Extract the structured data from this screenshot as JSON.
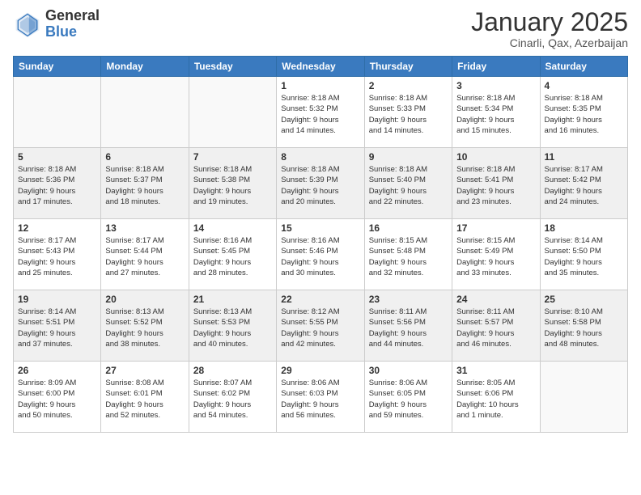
{
  "header": {
    "logo_general": "General",
    "logo_blue": "Blue",
    "month_title": "January 2025",
    "location": "Cinarli, Qax, Azerbaijan"
  },
  "weekdays": [
    "Sunday",
    "Monday",
    "Tuesday",
    "Wednesday",
    "Thursday",
    "Friday",
    "Saturday"
  ],
  "weeks": [
    [
      {
        "day": "",
        "info": ""
      },
      {
        "day": "",
        "info": ""
      },
      {
        "day": "",
        "info": ""
      },
      {
        "day": "1",
        "info": "Sunrise: 8:18 AM\nSunset: 5:32 PM\nDaylight: 9 hours\nand 14 minutes."
      },
      {
        "day": "2",
        "info": "Sunrise: 8:18 AM\nSunset: 5:33 PM\nDaylight: 9 hours\nand 14 minutes."
      },
      {
        "day": "3",
        "info": "Sunrise: 8:18 AM\nSunset: 5:34 PM\nDaylight: 9 hours\nand 15 minutes."
      },
      {
        "day": "4",
        "info": "Sunrise: 8:18 AM\nSunset: 5:35 PM\nDaylight: 9 hours\nand 16 minutes."
      }
    ],
    [
      {
        "day": "5",
        "info": "Sunrise: 8:18 AM\nSunset: 5:36 PM\nDaylight: 9 hours\nand 17 minutes."
      },
      {
        "day": "6",
        "info": "Sunrise: 8:18 AM\nSunset: 5:37 PM\nDaylight: 9 hours\nand 18 minutes."
      },
      {
        "day": "7",
        "info": "Sunrise: 8:18 AM\nSunset: 5:38 PM\nDaylight: 9 hours\nand 19 minutes."
      },
      {
        "day": "8",
        "info": "Sunrise: 8:18 AM\nSunset: 5:39 PM\nDaylight: 9 hours\nand 20 minutes."
      },
      {
        "day": "9",
        "info": "Sunrise: 8:18 AM\nSunset: 5:40 PM\nDaylight: 9 hours\nand 22 minutes."
      },
      {
        "day": "10",
        "info": "Sunrise: 8:18 AM\nSunset: 5:41 PM\nDaylight: 9 hours\nand 23 minutes."
      },
      {
        "day": "11",
        "info": "Sunrise: 8:17 AM\nSunset: 5:42 PM\nDaylight: 9 hours\nand 24 minutes."
      }
    ],
    [
      {
        "day": "12",
        "info": "Sunrise: 8:17 AM\nSunset: 5:43 PM\nDaylight: 9 hours\nand 25 minutes."
      },
      {
        "day": "13",
        "info": "Sunrise: 8:17 AM\nSunset: 5:44 PM\nDaylight: 9 hours\nand 27 minutes."
      },
      {
        "day": "14",
        "info": "Sunrise: 8:16 AM\nSunset: 5:45 PM\nDaylight: 9 hours\nand 28 minutes."
      },
      {
        "day": "15",
        "info": "Sunrise: 8:16 AM\nSunset: 5:46 PM\nDaylight: 9 hours\nand 30 minutes."
      },
      {
        "day": "16",
        "info": "Sunrise: 8:15 AM\nSunset: 5:48 PM\nDaylight: 9 hours\nand 32 minutes."
      },
      {
        "day": "17",
        "info": "Sunrise: 8:15 AM\nSunset: 5:49 PM\nDaylight: 9 hours\nand 33 minutes."
      },
      {
        "day": "18",
        "info": "Sunrise: 8:14 AM\nSunset: 5:50 PM\nDaylight: 9 hours\nand 35 minutes."
      }
    ],
    [
      {
        "day": "19",
        "info": "Sunrise: 8:14 AM\nSunset: 5:51 PM\nDaylight: 9 hours\nand 37 minutes."
      },
      {
        "day": "20",
        "info": "Sunrise: 8:13 AM\nSunset: 5:52 PM\nDaylight: 9 hours\nand 38 minutes."
      },
      {
        "day": "21",
        "info": "Sunrise: 8:13 AM\nSunset: 5:53 PM\nDaylight: 9 hours\nand 40 minutes."
      },
      {
        "day": "22",
        "info": "Sunrise: 8:12 AM\nSunset: 5:55 PM\nDaylight: 9 hours\nand 42 minutes."
      },
      {
        "day": "23",
        "info": "Sunrise: 8:11 AM\nSunset: 5:56 PM\nDaylight: 9 hours\nand 44 minutes."
      },
      {
        "day": "24",
        "info": "Sunrise: 8:11 AM\nSunset: 5:57 PM\nDaylight: 9 hours\nand 46 minutes."
      },
      {
        "day": "25",
        "info": "Sunrise: 8:10 AM\nSunset: 5:58 PM\nDaylight: 9 hours\nand 48 minutes."
      }
    ],
    [
      {
        "day": "26",
        "info": "Sunrise: 8:09 AM\nSunset: 6:00 PM\nDaylight: 9 hours\nand 50 minutes."
      },
      {
        "day": "27",
        "info": "Sunrise: 8:08 AM\nSunset: 6:01 PM\nDaylight: 9 hours\nand 52 minutes."
      },
      {
        "day": "28",
        "info": "Sunrise: 8:07 AM\nSunset: 6:02 PM\nDaylight: 9 hours\nand 54 minutes."
      },
      {
        "day": "29",
        "info": "Sunrise: 8:06 AM\nSunset: 6:03 PM\nDaylight: 9 hours\nand 56 minutes."
      },
      {
        "day": "30",
        "info": "Sunrise: 8:06 AM\nSunset: 6:05 PM\nDaylight: 9 hours\nand 59 minutes."
      },
      {
        "day": "31",
        "info": "Sunrise: 8:05 AM\nSunset: 6:06 PM\nDaylight: 10 hours\nand 1 minute."
      },
      {
        "day": "",
        "info": ""
      }
    ]
  ]
}
